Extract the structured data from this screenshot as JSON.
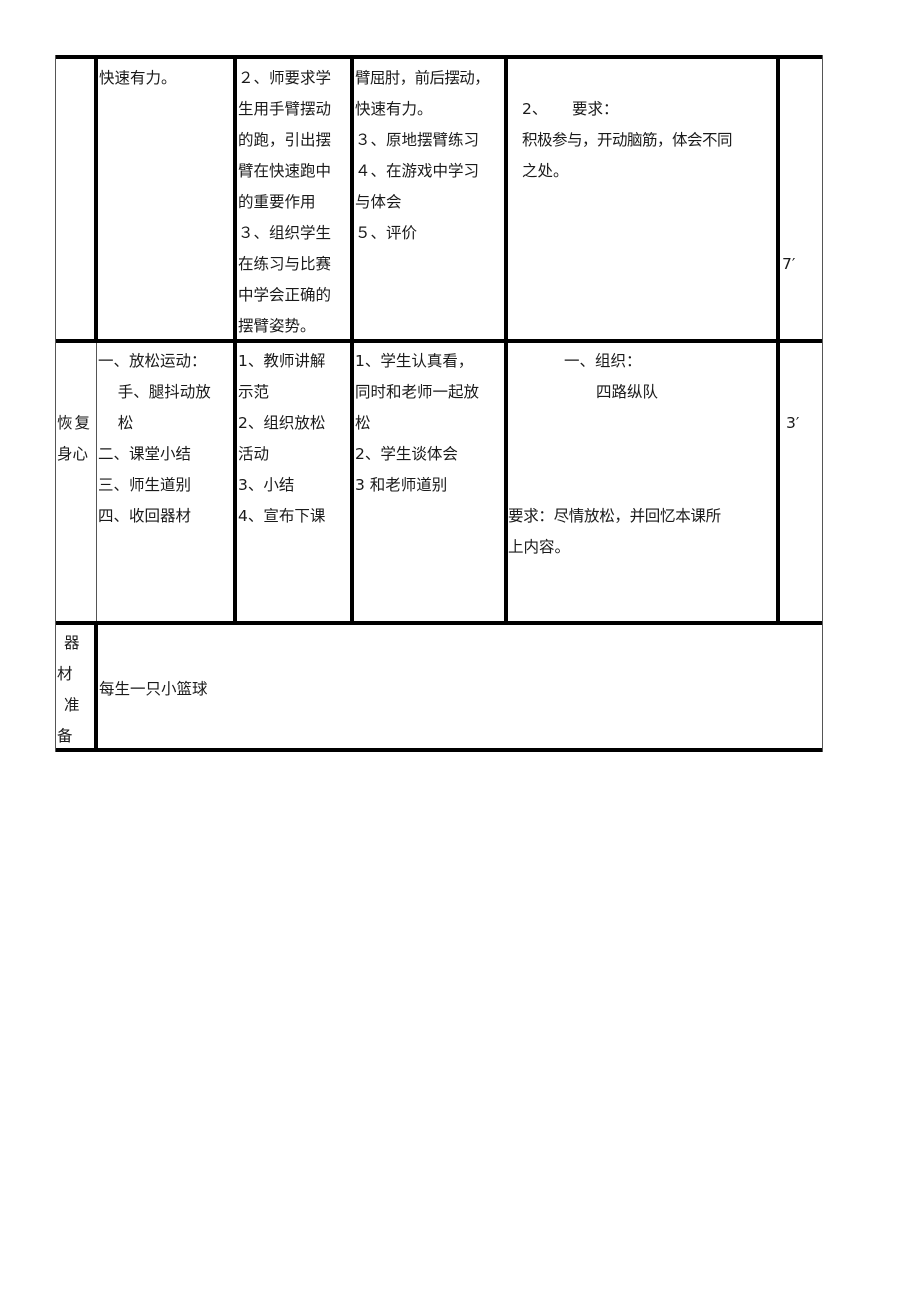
{
  "table": {
    "row_activity": {
      "section_label": "",
      "content_lines": [
        "快速有力。"
      ],
      "teacher_lines": [
        "２、师要求学",
        "生用手臂摆动",
        "的跑，引出摆",
        "臂在快速跑中",
        "的重要作用",
        "３、组织学生",
        "在练习与比赛",
        "中学会正确的",
        "摆臂姿势。"
      ],
      "student_lines": [
        "臂屈肘，前后摆动，",
        "快速有力。",
        "３、原地摆臂练习",
        "４、在游戏中学习",
        "与体会",
        "５、评价"
      ],
      "organization_lines": [
        "2、     要求：",
        "积极参与，开动脑筋，体会不同",
        "之处。"
      ],
      "time": "7′"
    },
    "row_recovery": {
      "section_label_lines": [
        "恢复",
        "身心"
      ],
      "content_lines": [
        "一、放松运动：",
        "    手、腿抖动放",
        "    松",
        "二、课堂小结",
        "三、师生道别",
        "四、收回器材"
      ],
      "teacher_lines": [
        "1、教师讲解",
        "示范",
        "2、组织放松",
        "活动",
        "3、小结",
        "4、宣布下课"
      ],
      "student_lines": [
        "1、学生认真看，",
        "同时和老师一起放",
        "松",
        "2、学生谈体会",
        "3 和老师道别"
      ],
      "organization_lines": [
        "一、组织：",
        "四路纵队",
        "要求：尽情放松，并回忆本课所",
        "上内容。"
      ],
      "time": "3′"
    },
    "row_equipment": {
      "label_chars": [
        "器",
        "材",
        "准",
        "备"
      ],
      "content": "每生一只小篮球"
    }
  }
}
